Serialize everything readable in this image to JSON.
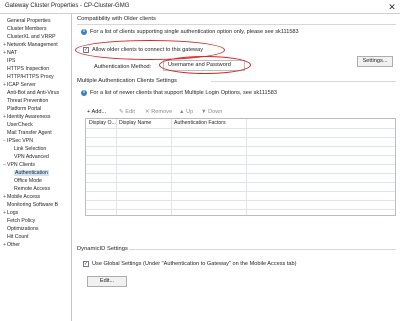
{
  "window": {
    "title": "Gateway Cluster Properties - CP-Cluster-GMG",
    "close_glyph": "✕"
  },
  "sidebar": {
    "items": [
      {
        "label": "General Properties",
        "toggle": ""
      },
      {
        "label": "Cluster Members",
        "toggle": ""
      },
      {
        "label": "ClusterXL and VRRP",
        "toggle": ""
      },
      {
        "label": "Network Management",
        "toggle": "+"
      },
      {
        "label": "NAT",
        "toggle": "+"
      },
      {
        "label": "IPS",
        "toggle": ""
      },
      {
        "label": "HTTPS Inspection",
        "toggle": ""
      },
      {
        "label": "HTTP/HTTPS Proxy",
        "toggle": ""
      },
      {
        "label": "ICAP Server",
        "toggle": "+"
      },
      {
        "label": "Anti-Bot and Anti-Virus",
        "toggle": ""
      },
      {
        "label": "Threat Prevention",
        "toggle": ""
      },
      {
        "label": "Platform Portal",
        "toggle": ""
      },
      {
        "label": "Identity Awareness",
        "toggle": "+"
      },
      {
        "label": "UserCheck",
        "toggle": ""
      },
      {
        "label": "Mail Transfer Agent",
        "toggle": ""
      },
      {
        "label": "IPSec VPN",
        "toggle": "−"
      },
      {
        "label": "Link Selection",
        "toggle": ""
      },
      {
        "label": "VPN Advanced",
        "toggle": ""
      },
      {
        "label": "VPN Clients",
        "toggle": "−"
      },
      {
        "label": "Authentication",
        "toggle": ""
      },
      {
        "label": "Office Mode",
        "toggle": ""
      },
      {
        "label": "Remote Access",
        "toggle": ""
      },
      {
        "label": "Mobile Access",
        "toggle": "+"
      },
      {
        "label": "Monitoring Software B",
        "toggle": ""
      },
      {
        "label": "Logs",
        "toggle": "+"
      },
      {
        "label": "Fetch Policy",
        "toggle": ""
      },
      {
        "label": "Optimizations",
        "toggle": ""
      },
      {
        "label": "Hit Count",
        "toggle": ""
      },
      {
        "label": "Other",
        "toggle": "+"
      }
    ]
  },
  "compat": {
    "title": "Compatibility with Older clients",
    "info": "For a list of clients supporting single authentication option only, please see sk111583",
    "allow_label": "Allow older clients to connect to this gateway",
    "allow_checked": "✓",
    "method_label": "Authentication Method:",
    "method_value": "Username and Password",
    "settings_button": "Settings..."
  },
  "multi": {
    "title": "Multiple Authentication Clients Settings",
    "info": "For a list of newer clients that support Multiple Login Options, see sk111583",
    "toolbar": {
      "add": "+ Add...",
      "edit": "✎ Edit",
      "remove": "✕ Remove",
      "up": "▲ Up",
      "down": "▼ Down"
    },
    "columns": [
      "Display O...",
      "Display Name",
      "Authentication Factors"
    ]
  },
  "dynamic": {
    "title": "DynamicID Settings",
    "global_label": "Use Global Settings (Under \"Authentication to Gateway\" on the Mobile Access tab)",
    "global_checked": "✓",
    "edit_button": "Edit..."
  },
  "colors": {
    "accent": "#3b7fc4",
    "highlight": "#d7262b",
    "selection": "#cfe3f7"
  }
}
